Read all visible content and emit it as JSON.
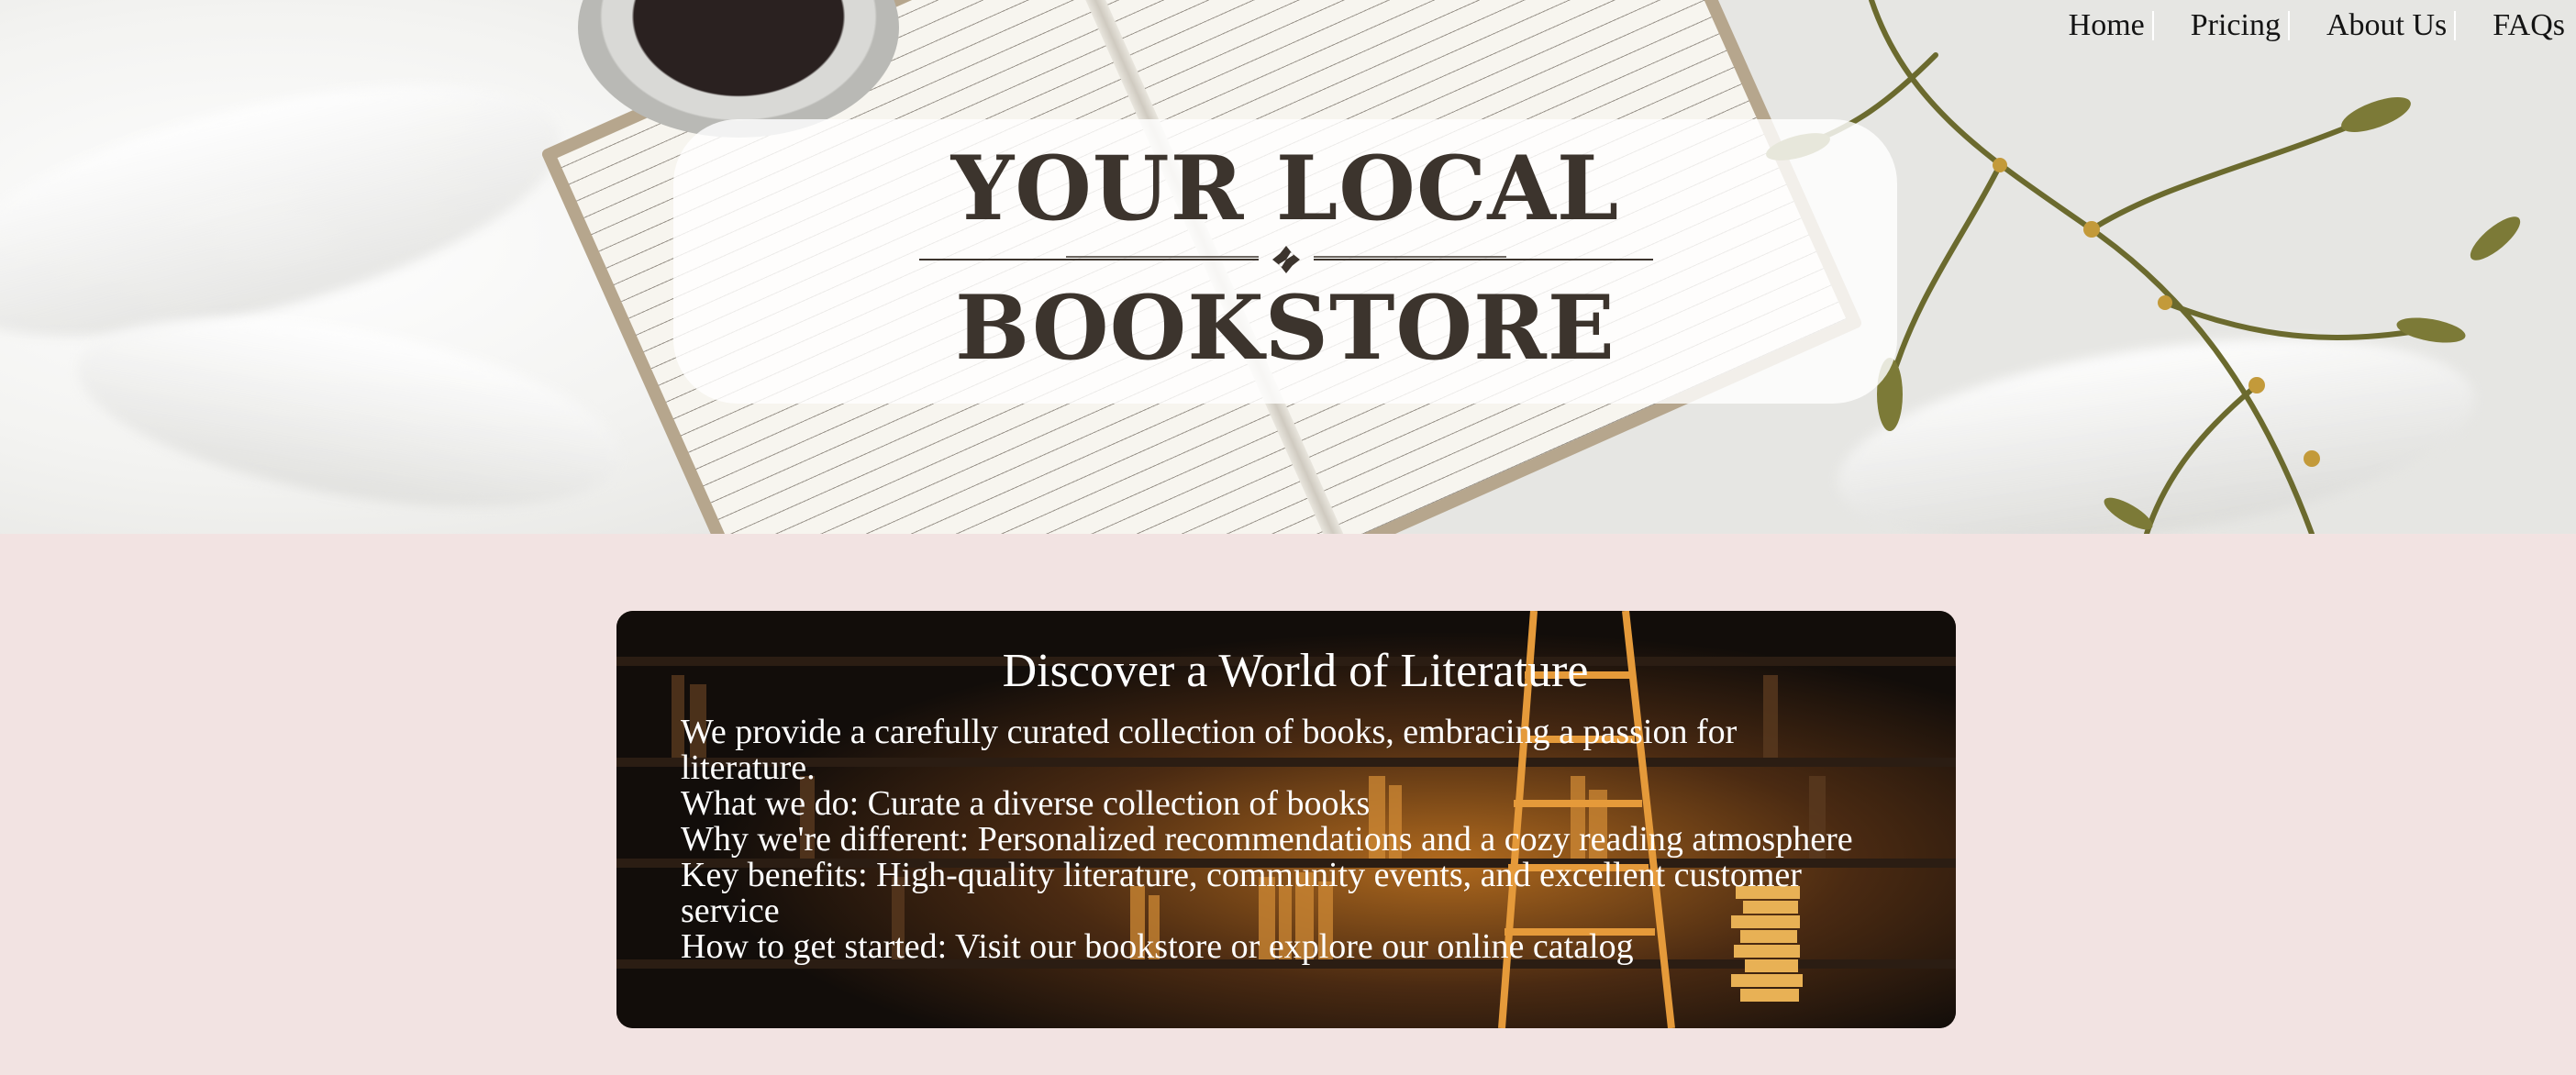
{
  "nav": {
    "items": [
      "Home",
      "Pricing",
      "About Us",
      "FAQs"
    ]
  },
  "hero": {
    "title_line1": "YOUR LOCAL",
    "title_line2": "BOOKSTORE"
  },
  "info": {
    "heading": "Discover a World of Literature",
    "intro": "We provide a carefully curated collection of books, embracing a passion for literature.",
    "lines": [
      "What we do: Curate a diverse collection of books",
      "Why we're different: Personalized recommendations and a cozy reading atmosphere",
      "Key benefits: High-quality literature, community events, and excellent customer service",
      "How to get started: Visit our bookstore or explore our online catalog"
    ]
  },
  "colors": {
    "page_background": "#f2e3e2",
    "title_text": "#3c342d",
    "nav_text": "#141414",
    "card_text": "#ffffff"
  }
}
